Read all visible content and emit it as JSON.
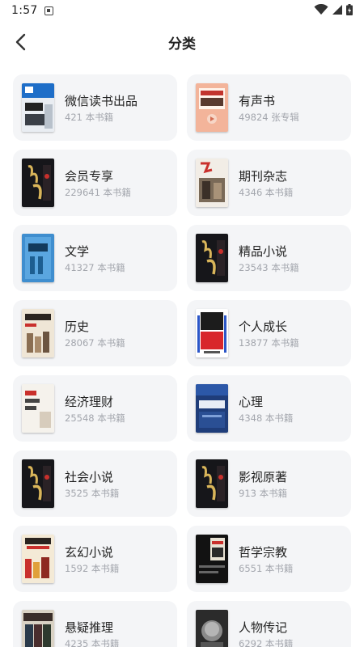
{
  "status_bar": {
    "time": "1:57"
  },
  "header": {
    "title": "分类"
  },
  "categories": [
    {
      "name": "微信读书出品",
      "count": "421 本书籍",
      "cover": "weread-cover"
    },
    {
      "name": "有声书",
      "count": "49824 张专辑",
      "cover": "audiobook-cover"
    },
    {
      "name": "会员专享",
      "count": "229641 本书籍",
      "cover": "member-cover"
    },
    {
      "name": "期刊杂志",
      "count": "4346 本书籍",
      "cover": "magazine-cover"
    },
    {
      "name": "文学",
      "count": "41327 本书籍",
      "cover": "literature-cover"
    },
    {
      "name": "精品小说",
      "count": "23543 本书籍",
      "cover": "novel-cover"
    },
    {
      "name": "历史",
      "count": "28067 本书籍",
      "cover": "history-cover"
    },
    {
      "name": "个人成长",
      "count": "13877 本书籍",
      "cover": "growth-cover"
    },
    {
      "name": "经济理财",
      "count": "25548 本书籍",
      "cover": "finance-cover"
    },
    {
      "name": "心理",
      "count": "4348 本书籍",
      "cover": "psychology-cover"
    },
    {
      "name": "社会小说",
      "count": "3525 本书籍",
      "cover": "social-novel-cover"
    },
    {
      "name": "影视原著",
      "count": "913 本书籍",
      "cover": "film-cover"
    },
    {
      "name": "玄幻小说",
      "count": "1592 本书籍",
      "cover": "fantasy-cover"
    },
    {
      "name": "哲学宗教",
      "count": "6551 本书籍",
      "cover": "philosophy-cover"
    },
    {
      "name": "悬疑推理",
      "count": "4235 本书籍",
      "cover": "mystery-cover"
    },
    {
      "name": "人物传记",
      "count": "6292 本书籍",
      "cover": "biography-cover"
    }
  ]
}
